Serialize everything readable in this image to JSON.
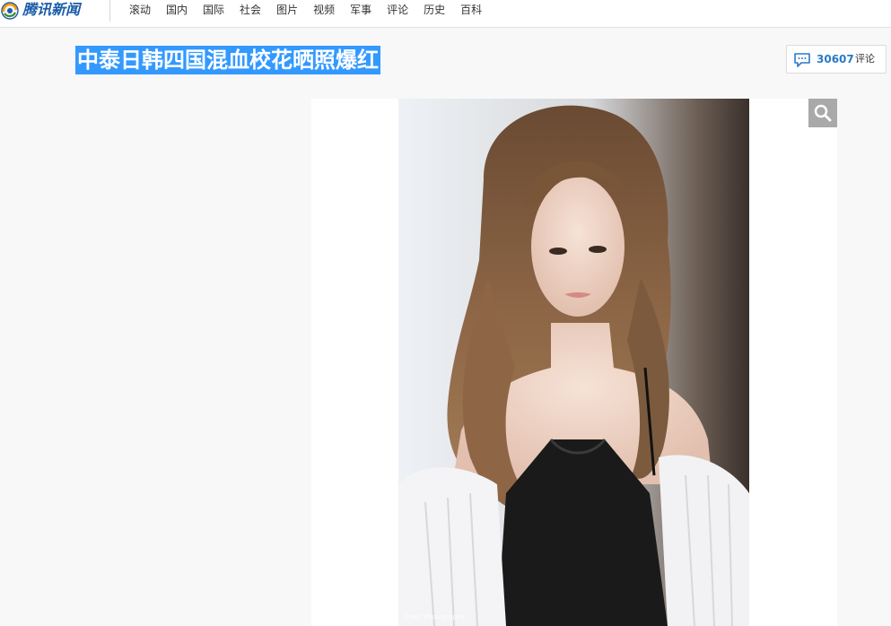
{
  "brand": {
    "logo_text": "腾讯新闻"
  },
  "nav": {
    "items": [
      "滚动",
      "国内",
      "国际",
      "社会",
      "图片",
      "视频",
      "军事",
      "评论",
      "历史",
      "百科"
    ]
  },
  "article": {
    "title": "中泰日韩四国混血校花晒照爆红"
  },
  "comments": {
    "count": "30607",
    "label": "评论"
  },
  "photo": {
    "watermark": "©NAT Photography"
  },
  "icons": {
    "logo": "tencent-news-logo-icon",
    "comment": "comment-bubble-icon",
    "zoom": "magnifier-icon"
  },
  "colors": {
    "title_highlight": "#3399ff",
    "comment_count": "#2a7ac6",
    "zoom_button": "#a9a9a9",
    "brand": "#1a5ca9"
  }
}
